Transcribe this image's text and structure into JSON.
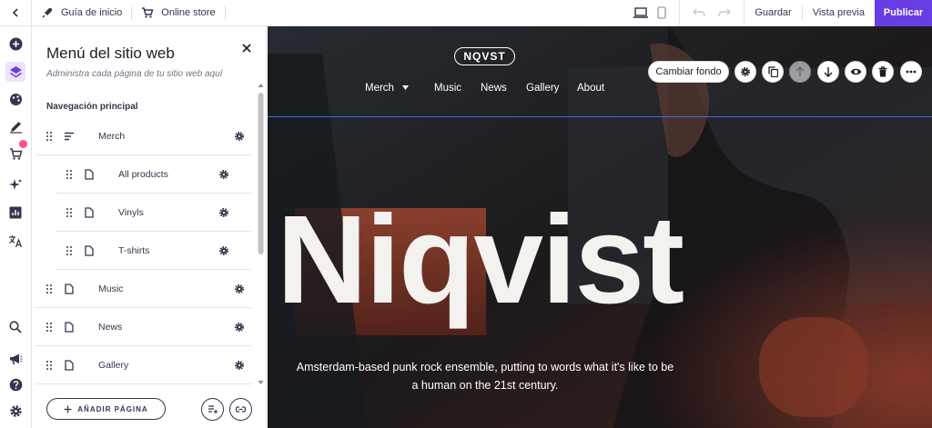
{
  "topbar": {
    "guide_label": "Guía de inicio",
    "store_label": "Online store",
    "save_label": "Guardar",
    "preview_label": "Vista previa",
    "publish_label": "Publicar"
  },
  "panel": {
    "title": "Menú del sitio web",
    "subtitle": "Administra cada página de tu sitio web aquí",
    "section_label": "Navegación principal",
    "items": [
      {
        "label": "Merch",
        "icon": "list-icon",
        "level": 0
      },
      {
        "label": "All products",
        "icon": "page-icon",
        "level": 1
      },
      {
        "label": "Vinyls",
        "icon": "page-icon",
        "level": 1
      },
      {
        "label": "T-shirts",
        "icon": "page-icon",
        "level": 1
      },
      {
        "label": "Music",
        "icon": "page-icon",
        "level": 0
      },
      {
        "label": "News",
        "icon": "page-icon",
        "level": 0
      },
      {
        "label": "Gallery",
        "icon": "page-icon",
        "level": 0
      }
    ],
    "add_page_label": "AÑADIR PÁGINA"
  },
  "canvas": {
    "logo": "NQVST",
    "nav": [
      "Merch",
      "Music",
      "News",
      "Gallery",
      "About"
    ],
    "hero_title": "Niqvist",
    "tagline_1": "Amsterdam-based punk rock ensemble, putting to words what it's like to be",
    "tagline_2": "a human on the 21st century.",
    "toolbar": {
      "background_label": "Cambiar fondo"
    }
  },
  "colors": {
    "accent": "#673de6",
    "badge": "#fc5185",
    "guide_line": "#3f6be0"
  }
}
